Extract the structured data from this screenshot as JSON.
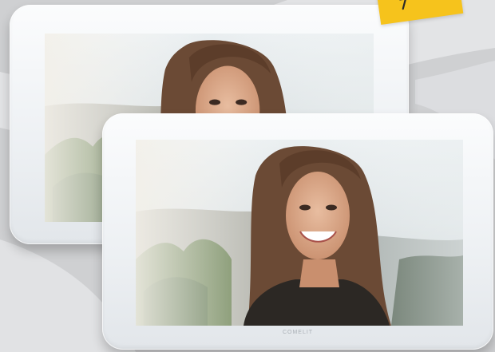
{
  "scene": {
    "background_color": "#cfd0d2",
    "monitor_color": "#f2f4f6",
    "badge_color": "#f6c31c"
  },
  "monitors": [
    {
      "id": "back",
      "screen_content": "smiling-woman-photo"
    },
    {
      "id": "front",
      "screen_content": "smiling-woman-photo",
      "brand_label": "COMELIT"
    }
  ],
  "badge": {
    "icon": "arrow-mark-icon"
  }
}
